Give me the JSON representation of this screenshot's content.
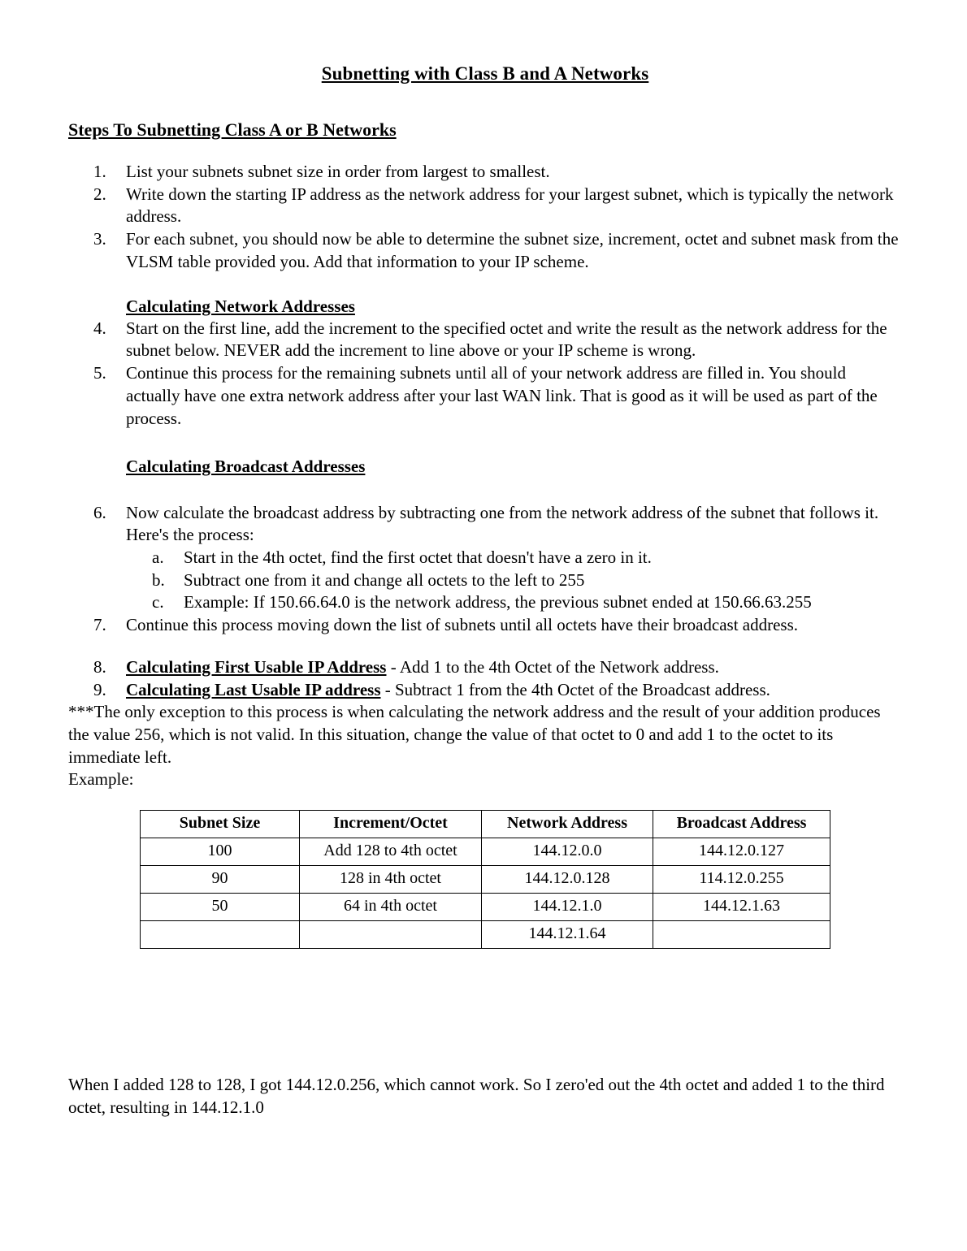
{
  "document": {
    "title": "Subnetting with Class B and A Networks",
    "section_heading": "Steps To Subnetting Class A or B Networks",
    "sub_heading_network": "Calculating Network Addresses",
    "sub_heading_broadcast": "Calculating Broadcast Addresses",
    "example_label": "Example:",
    "exception_note": "***The only exception to this process is when calculating the network address and the result of your addition produces the value 256, which is not valid.  In this situation, change the value of that octet to 0 and add 1 to the octet to its immediate left.",
    "footnote": "When I added 128 to 128, I got 144.12.0.256, which cannot work.  So I zero'ed out the 4th octet and added 1 to the third octet, resulting in 144.12.1.0"
  },
  "steps": [
    {
      "marker": "1.",
      "text": "List your subnets subnet size in order from largest to smallest."
    },
    {
      "marker": "2.",
      "text": "Write down the starting IP address as the network address for your largest subnet, which is typically the network address."
    },
    {
      "marker": "3.",
      "text": "For each subnet, you should now be able to determine the subnet size, increment, octet and subnet mask from the VLSM table provided you.  Add that information to your IP scheme."
    },
    {
      "marker": "4.",
      "text": "Start on the first line, add the increment to the specified octet and write the result as the network address for the subnet below.  NEVER add the increment to line above or your IP scheme is wrong."
    },
    {
      "marker": "5.",
      "text": "Continue this process for the remaining subnets until all of your network address are filled in.  You should actually have one extra network address after your last WAN link.  That is good as it will be used as part of the process."
    },
    {
      "marker": "6.",
      "text": "Now calculate the broadcast address by subtracting one from the network address of the subnet that follows it.  Here's the process:"
    },
    {
      "marker": "7.",
      "text": "Continue this process moving down the list of subnets until all octets have their broadcast address."
    }
  ],
  "sub_steps": [
    {
      "marker": "a.",
      "text": "Start in the 4th octet, find the first octet that doesn't have a zero in it."
    },
    {
      "marker": "b.",
      "text": "Subtract one from it and change all octets to the left to 255"
    },
    {
      "marker": "c.",
      "text": "Example:  If 150.66.64.0 is the network address, the previous subnet ended at 150.66.63.255"
    }
  ],
  "usable_ip_steps": [
    {
      "marker": "8.",
      "emphasis": "Calculating First Usable IP Address",
      "text": " - Add 1 to the 4th Octet of the Network address."
    },
    {
      "marker": "9.",
      "emphasis": "Calculating Last Usable IP address",
      "text": " - Subtract 1 from the 4th Octet of the Broadcast address."
    }
  ],
  "example_table": {
    "headers": [
      "Subnet Size",
      "Increment/Octet",
      "Network Address",
      "Broadcast Address"
    ],
    "rows": [
      [
        "100",
        "Add 128 to 4th octet",
        "144.12.0.0",
        "144.12.0.127"
      ],
      [
        "90",
        "128 in 4th octet",
        "144.12.0.128",
        "114.12.0.255"
      ],
      [
        "50",
        "64 in 4th octet",
        "144.12.1.0",
        "144.12.1.63"
      ],
      [
        "",
        "",
        "144.12.1.64",
        ""
      ]
    ]
  }
}
